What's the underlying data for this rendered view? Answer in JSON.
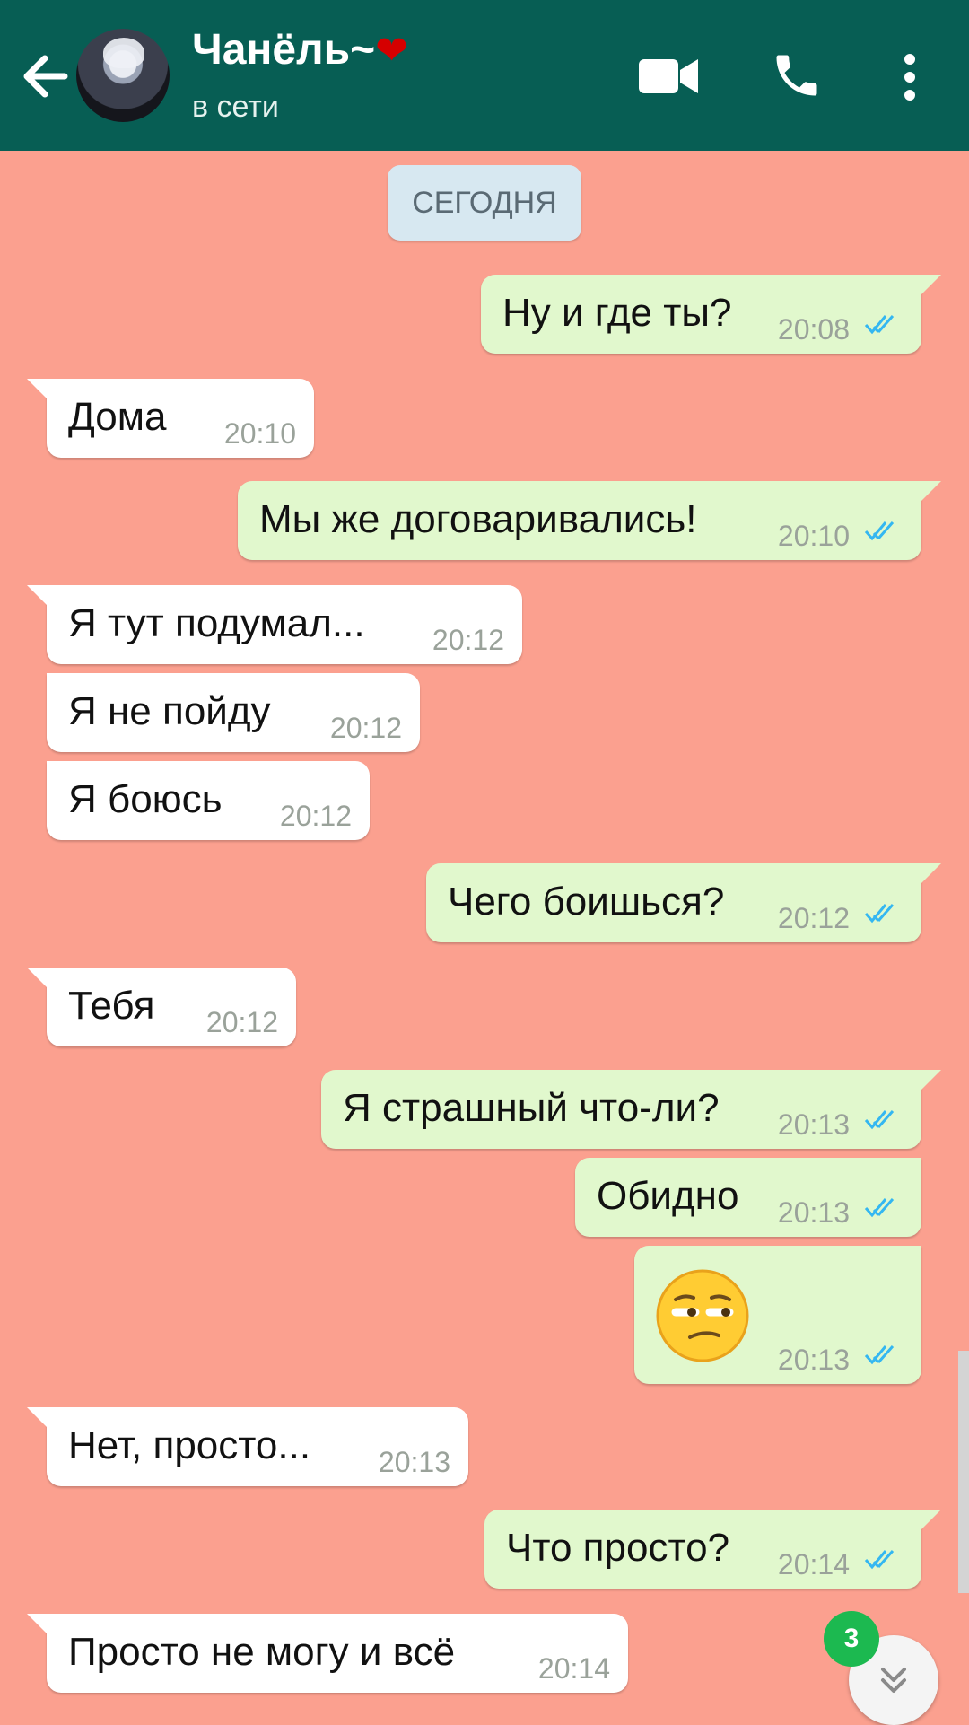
{
  "header": {
    "contact_name": "Чанёль~",
    "contact_emoji": "❤",
    "status": "в сети",
    "icons": [
      "back-arrow-icon",
      "video-call-icon",
      "phone-call-icon",
      "more-options-icon"
    ],
    "background": "#075e54"
  },
  "chat": {
    "date_separator": "СЕГОДНЯ",
    "background": "#fba08f",
    "messages": [
      {
        "direction": "out",
        "text": "Ну и где ты?",
        "time": "20:08",
        "status": "read"
      },
      {
        "direction": "in",
        "text": "Дома",
        "time": "20:10"
      },
      {
        "direction": "out",
        "text": "Мы же договаривались!",
        "time": "20:10",
        "status": "read"
      },
      {
        "direction": "in",
        "text": "Я тут подумал...",
        "time": "20:12"
      },
      {
        "direction": "in",
        "text": "Я не пойду",
        "time": "20:12"
      },
      {
        "direction": "in",
        "text": "Я боюсь",
        "time": "20:12"
      },
      {
        "direction": "out",
        "text": "Чего боишься?",
        "time": "20:12",
        "status": "read"
      },
      {
        "direction": "in",
        "text": "Тебя",
        "time": "20:12"
      },
      {
        "direction": "out",
        "text": "Я страшный что-ли?",
        "time": "20:13",
        "status": "read"
      },
      {
        "direction": "out",
        "text": "Обидно",
        "time": "20:13",
        "status": "read"
      },
      {
        "direction": "out",
        "emoji": "unamused-face-emoji",
        "time": "20:13",
        "status": "read"
      },
      {
        "direction": "in",
        "text": "Нет, просто...",
        "time": "20:13"
      },
      {
        "direction": "out",
        "text": "Что просто?",
        "time": "20:14",
        "status": "read"
      },
      {
        "direction": "in",
        "text": "Просто не могу и всё",
        "time": "20:14"
      }
    ]
  },
  "scroll_button": {
    "unread_count": "3",
    "icon": "double-chevron-down-icon"
  },
  "colors": {
    "outgoing_bubble": "#e1f8cd",
    "incoming_bubble": "#ffffff",
    "read_ticks": "#34b7f1",
    "badge": "#1cb950"
  }
}
